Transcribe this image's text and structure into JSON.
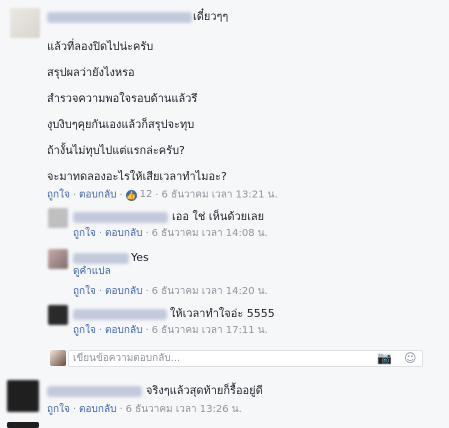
{
  "comment_main": {
    "suffix": "เดี๋ยวๆๆ",
    "lines": [
      "แล้วที่ลองปิดไปน่ะครับ",
      "สรุปผลว่ายังไงหรอ",
      "สำรวจความพอใจรอบด้านแล้วรึ",
      "งุบงิบๆคุยกันเองแล้วก็สรุปจะทุบ",
      "ถ้างั้นไม่ทุบไปแต่แรกล่ะครับ?",
      "จะมาทดลองอะไรให้เสียเวลาทำไมอะ?"
    ],
    "like_label": "ถูกใจ",
    "reply_label": "ตอบกลับ",
    "reaction_count": "12",
    "timestamp": "6 ธันวาคม เวลา 13:21 น."
  },
  "replies": [
    {
      "text": "เออ ใช่ เห็นด้วยเลย",
      "like_label": "ถูกใจ",
      "reply_label": "ตอบกลับ",
      "timestamp": "6 ธันวาคม เวลา 14:08 น."
    },
    {
      "text": "Yes",
      "see_translation": "ดูคำแปล",
      "like_label": "ถูกใจ",
      "reply_label": "ตอบกลับ",
      "timestamp": "6 ธันวาคม เวลา 14:20 น."
    },
    {
      "text": "ให้เวลาทำใจอ่ะ 5555",
      "like_label": "ถูกใจ",
      "reply_label": "ตอบกลับ",
      "timestamp": "6 ธันวาคม เวลา 17:11 น."
    }
  ],
  "reply_box": {
    "placeholder": "เขียนข้อความตอบกลับ..."
  },
  "comment_second": {
    "text": "จริงๆแล้วสุดท้ายก็รื้ออยู่ดี",
    "like_label": "ถูกใจ",
    "reply_label": "ตอบกลับ",
    "timestamp": "6 ธันวาคม เวลา 13:26 น."
  },
  "colors": {
    "link": "#4267b2",
    "meta": "#90949c",
    "background": "#f6f7f9"
  }
}
